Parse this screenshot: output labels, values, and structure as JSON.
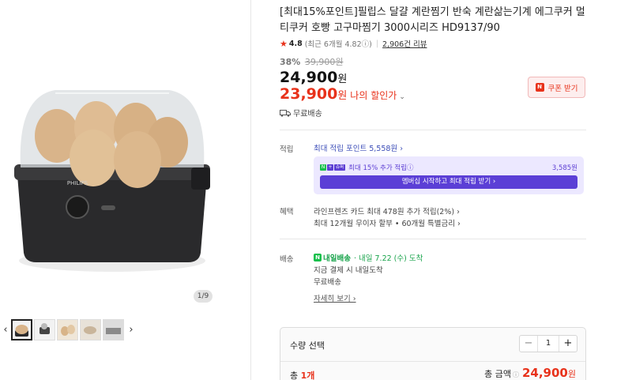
{
  "gallery": {
    "counter": "1/9",
    "prev": "‹",
    "next": "›"
  },
  "product": {
    "title": "[최대15%포인트]필립스 달걀 계란찜기 반숙 계란삶는기계 에그쿠커 멀티쿠커 호빵 고구마찜기 3000시리즈 HD9137/90",
    "rating": "4.8",
    "recent_rating": "(최근 6개월 4.82ⓘ)",
    "review_count": "2,906건 리뷰",
    "discount_rate": "38%",
    "original_price": "39,900원",
    "price": "24,900",
    "price_unit": "원",
    "my_price": "23,900",
    "my_price_unit": "원",
    "my_price_label": "나의 할인가",
    "coupon_label": "쿠폰 받기",
    "shipping": "무료배송"
  },
  "points": {
    "label": "적립",
    "max_points": "최대 적립 포인트 5,558원 ›",
    "membership_text": "최대 15% 추가 적립ⓘ",
    "membership_amount": "3,585원",
    "membership_button": "멤버십 시작하고 최대 적립 받기 ›"
  },
  "benefits": {
    "label": "혜택",
    "card": "라인프렌즈 카드 최대 478원 추가 적립(2%) ›",
    "installment": "최대 12개월 무이자 할부 • 60개월 특별금리 ›"
  },
  "delivery": {
    "label": "배송",
    "badge": "내일배송",
    "date": "· 내일 7.22 (수) 도착",
    "note": "지금 결제 시 내일도착",
    "fee": "무료배송",
    "detail_link": "자세히 보기 ›"
  },
  "quantity": {
    "label": "수량 선택",
    "value": "1",
    "minus": "−",
    "plus": "+",
    "total_prefix": "총 ",
    "total_count": "1개",
    "total_label": "총 금액",
    "total_price": "24,900",
    "total_unit": "원"
  },
  "colors": {
    "accent_red": "#e8321b",
    "membership_purple": "#5b3fd6",
    "delivery_green": "#17a34a"
  }
}
